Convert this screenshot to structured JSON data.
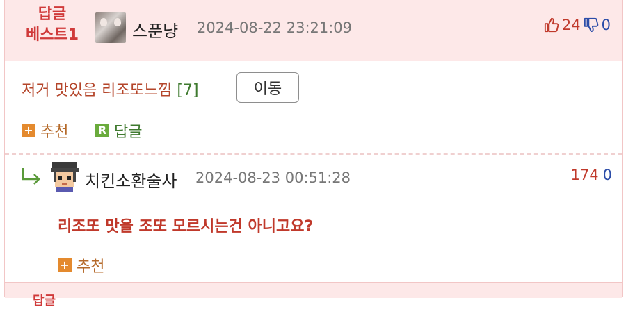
{
  "best_comment": {
    "badge_line1": "답글",
    "badge_line2": "베스트1",
    "author": "스푼냥",
    "datetime": "2024-08-22 23:21:09",
    "likes": "24",
    "dislikes": "0",
    "body": "저거 맛있음 리조또느낌",
    "reply_count": "[7]",
    "move_button": "이동",
    "recommend_label": "추천",
    "recommend_icon": "+",
    "reply_label": "답글",
    "reply_icon": "R"
  },
  "reply": {
    "author": "치킨소환술사",
    "datetime": "2024-08-23 00:51:28",
    "likes": "174",
    "dislikes": "0",
    "body": "리조또 맛을 조또 모르시는건 아니고요?",
    "recommend_label": "추천",
    "recommend_icon": "+"
  },
  "next_item_peek": "답글",
  "colors": {
    "best_bg": "#fde8e8",
    "badge_red": "#d03a3a",
    "like_red": "#c0392b",
    "dislike_blue": "#2b4ca8",
    "recommend_orange": "#e48a2e",
    "reply_green": "#6aab3c"
  },
  "icons": [
    "thumbs-up-icon",
    "thumbs-down-icon",
    "plus-square-icon",
    "reply-square-icon",
    "reply-arrow-icon",
    "avatar-icon"
  ]
}
